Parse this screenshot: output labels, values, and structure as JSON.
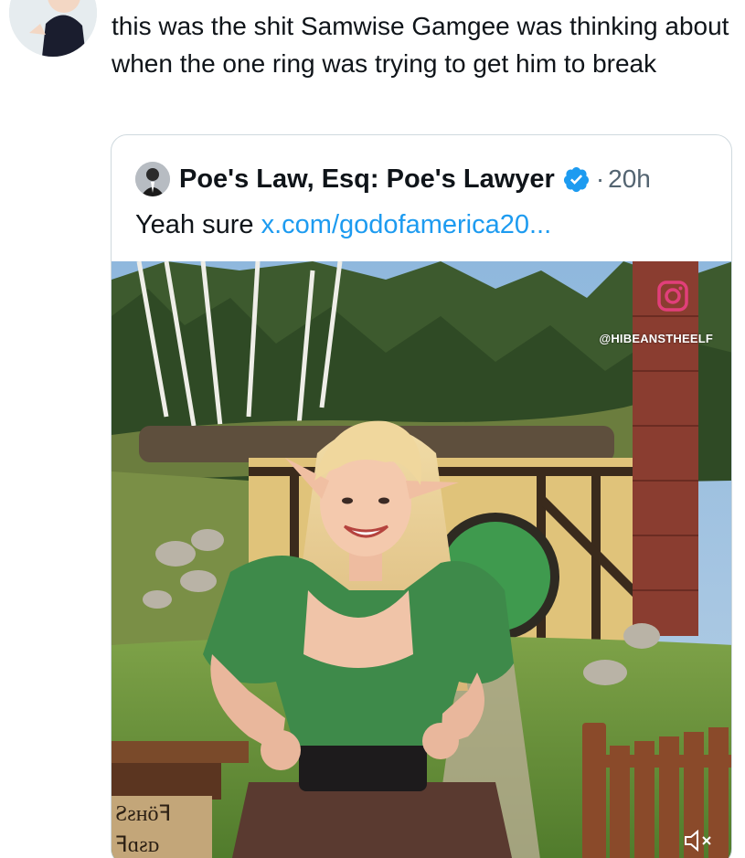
{
  "tweet": {
    "text": "this was the shit Samwise Gamgee was thinking about when the one ring was trying to get him to break"
  },
  "quote": {
    "author_name": "Poe's Law, Esq: Poe's Lawyer",
    "separator": "·",
    "time": "20h",
    "body_prefix": "Yeah sure ",
    "link_text": "x.com/godofamerica20..."
  },
  "media": {
    "watermark_handle": "@HIBEANSTHEELF",
    "icons": [
      "instagram-icon",
      "mute-icon"
    ],
    "sign_text": "Ƨƨнöꟻ\nꟻɑƨᴅ"
  },
  "colors": {
    "link": "#1d9bf0",
    "verified": "#1d9bf0",
    "border": "#cfd9de",
    "secondary_text": "#536471"
  }
}
